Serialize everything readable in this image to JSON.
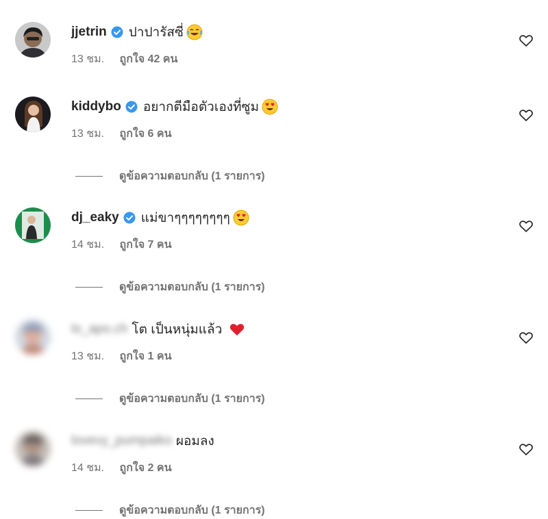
{
  "comments": [
    {
      "username": "jjetrin",
      "verified": true,
      "text": "ปาปารัสซี่",
      "emoji": "laughing-face-icon",
      "time": "13 ชม.",
      "likes": "ถูกใจ 42 คน",
      "replies_label": ""
    },
    {
      "username": "kiddybo",
      "verified": true,
      "text": "อยากตีมือตัวเองที่ซูม",
      "emoji": "heart-eyes-icon",
      "time": "13 ชม.",
      "likes": "ถูกใจ 6 คน",
      "replies_label": "ดูข้อความตอบกลับ (1 รายการ)"
    },
    {
      "username": "dj_eaky",
      "verified": true,
      "text": "แม่ขาๆๆๆๆๆๆๆๆ",
      "emoji": "heart-eyes-icon",
      "time": "14 ชม.",
      "likes": "ถูกใจ 7 คน",
      "replies_label": "ดูข้อความตอบกลับ (1 รายการ)"
    },
    {
      "username": "lo_apo.ch",
      "verified": false,
      "text": "โต เป็นหนุ่มแล้ว",
      "emoji": "red-heart-icon",
      "time": "13 ชม.",
      "likes": "ถูกใจ 1 คน",
      "replies_label": "ดูข้อความตอบกลับ (1 รายการ)"
    },
    {
      "username": "lovevy_pumpaiko",
      "verified": false,
      "text": "ผอมลง",
      "emoji": "",
      "time": "14 ชม.",
      "likes": "ถูกใจ 2 คน",
      "replies_label": "ดูข้อความตอบกลับ (1 รายการ)"
    }
  ],
  "icons": {
    "like": "heart-outline-icon",
    "verified": "verified-badge-icon"
  },
  "colors": {
    "verified": "#3897f0",
    "muted": "#737373",
    "text": "#262626"
  }
}
